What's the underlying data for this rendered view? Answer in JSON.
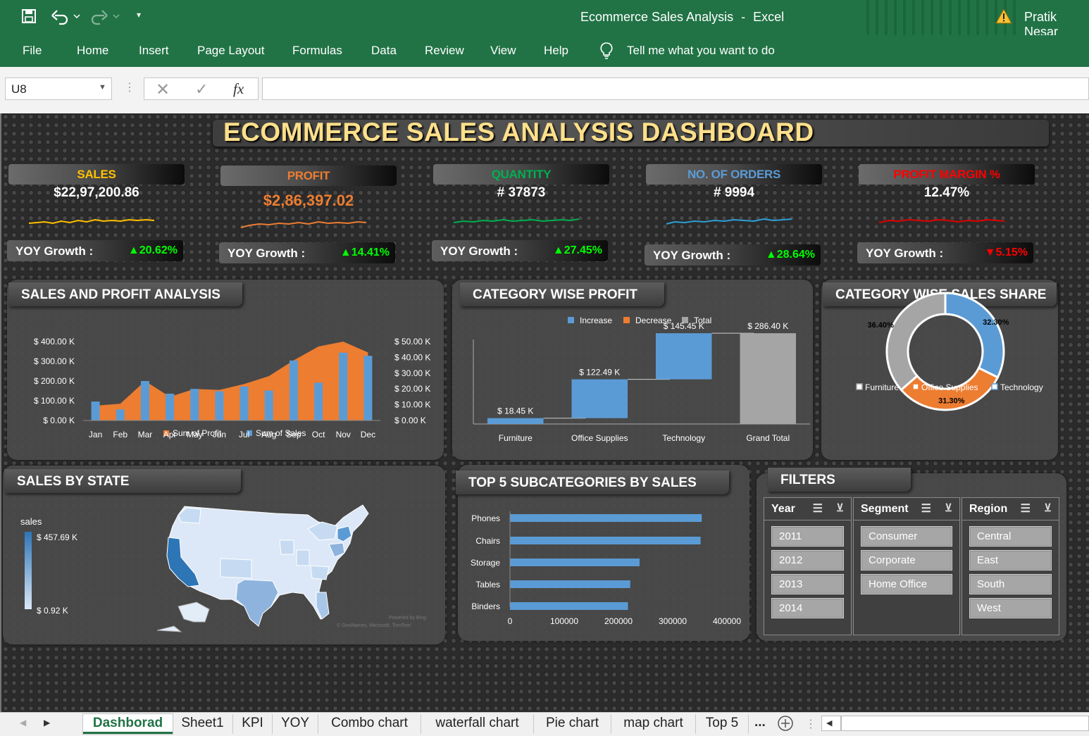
{
  "window": {
    "title": "Ecommerce Sales Analysis",
    "separator": "-",
    "app": "Excel",
    "user": "Pratik Nesar"
  },
  "ribbon": {
    "tabs": [
      "File",
      "Home",
      "Insert",
      "Page Layout",
      "Formulas",
      "Data",
      "Review",
      "View",
      "Help"
    ],
    "tell_me": "Tell me what you want to do"
  },
  "formula_bar": {
    "name_box": "U8",
    "fx": "fx",
    "formula": ""
  },
  "dashboard": {
    "title": "ECOMMERCE SALES ANALYSIS DASHBOARD"
  },
  "kpis": [
    {
      "label": "SALES",
      "value": "$22,97,200.86",
      "yoy_label": "YOY Growth :",
      "yoy": "▲20.62%",
      "label_color": "#ffc000",
      "value_color": "#ffffff",
      "line_color": "#ffc000",
      "yoy_color": "#00ff00"
    },
    {
      "label": "PROFIT",
      "value": "$2,86,397.02",
      "yoy_label": "YOY Growth :",
      "yoy": "▲14.41%",
      "label_color": "#ed7d31",
      "value_color": "#ed7d31",
      "line_color": "#ed7d31",
      "yoy_color": "#00ff00"
    },
    {
      "label": "QUANTITY",
      "value": "# 37873",
      "yoy_label": "YOY Growth :",
      "yoy": "▲27.45%",
      "label_color": "#00b050",
      "value_color": "#ffffff",
      "line_color": "#00b050",
      "yoy_color": "#00ff00"
    },
    {
      "label": "NO. OF ORDERS",
      "value": "# 9994",
      "yoy_label": "YOY Growth :",
      "yoy": "▲28.64%",
      "label_color": "#5b9bd5",
      "value_color": "#ffffff",
      "line_color": "#2e9fd6",
      "yoy_color": "#00ff00"
    },
    {
      "label": "PROFIT MARGIN %",
      "value": "12.47%",
      "yoy_label": "YOY Growth :",
      "yoy": "▼5.15%",
      "label_color": "#ff0000",
      "value_color": "#ffffff",
      "line_color": "#e00000",
      "yoy_color": "#ff0000"
    }
  ],
  "panels": {
    "sales_profit": "SALES AND PROFIT ANALYSIS",
    "category_profit": "CATEGORY WISE PROFIT",
    "category_share": "CATEGORY WISE SALES SHARE",
    "sales_by_state": "SALES BY STATE",
    "top5": "TOP 5 SUBCATEGORIES BY SALES",
    "filters": "FILTERS"
  },
  "chart_data": [
    {
      "type": "bar",
      "name": "combo",
      "categories": [
        "Jan",
        "Feb",
        "Mar",
        "Apr",
        "May",
        "Jun",
        "Jul",
        "Aug",
        "Sep",
        "Oct",
        "Nov",
        "Dec"
      ],
      "series": [
        {
          "name": "Sum of Profit",
          "type": "area",
          "axis": "left",
          "color": "#ed7d31",
          "values": [
            75,
            85,
            200,
            120,
            160,
            155,
            185,
            225,
            305,
            375,
            400,
            345
          ]
        },
        {
          "name": "Sum of Sales",
          "type": "bar",
          "axis": "right",
          "color": "#5b9bd5",
          "values": [
            12,
            7,
            25,
            17,
            20,
            18.5,
            21.5,
            19,
            38,
            24,
            43,
            41
          ]
        }
      ],
      "left_ticks": [
        "$ 400.00 K",
        "$ 300.00 K",
        "$ 200.00 K",
        "$ 100.00 K",
        "$ 0.00 K"
      ],
      "right_ticks": [
        "$ 50.00 K",
        "$ 40.00 K",
        "$ 30.00 K",
        "$ 20.00 K",
        "$ 10.00 K",
        "$ 0.00 K"
      ],
      "ylim_left": [
        0,
        400
      ],
      "ylim_right": [
        0,
        50
      ]
    },
    {
      "type": "bar",
      "name": "waterfall",
      "categories": [
        "Furniture",
        "Office Supplies",
        "Technology",
        "Grand Total"
      ],
      "legend": [
        "Increase",
        "Decrease",
        "Total"
      ],
      "values": [
        18.45,
        122.49,
        145.45,
        286.4
      ],
      "labels": [
        "$ 18.45 K",
        "$ 122.49 K",
        "$ 145.45 K",
        "$ 286.40 K"
      ],
      "ylim": [
        0,
        300
      ]
    },
    {
      "type": "pie",
      "name": "donut",
      "categories": [
        "Furniture",
        "Office Supplies",
        "Technology"
      ],
      "values": [
        36.4,
        31.3,
        32.3
      ],
      "labels": [
        "36.40%",
        "31.30%",
        "32.30%"
      ],
      "colors": [
        "#a5a5a5",
        "#ed7d31",
        "#5b9bd5"
      ]
    },
    {
      "type": "bar",
      "name": "top5",
      "categories": [
        "Phones",
        "Chairs",
        "Storage",
        "Tables",
        "Binders"
      ],
      "values": [
        330000,
        328000,
        223000,
        207000,
        203000
      ],
      "ticks": [
        "0",
        "100000",
        "200000",
        "300000",
        "400000"
      ],
      "xlim": [
        0,
        400000
      ]
    }
  ],
  "map": {
    "legend_title": "sales",
    "max": "$ 457.69 K",
    "min": "$ 0.92 K",
    "credit1": "Powered by Bing",
    "credit2": "© GeoNames, Microsoft, TomTom"
  },
  "slicers": [
    {
      "title": "Year",
      "items": [
        "2011",
        "2012",
        "2013",
        "2014"
      ]
    },
    {
      "title": "Segment",
      "items": [
        "Consumer",
        "Corporate",
        "Home Office"
      ]
    },
    {
      "title": "Region",
      "items": [
        "Central",
        "East",
        "South",
        "West"
      ]
    }
  ],
  "sheet_tabs": [
    "Dashborad",
    "Sheet1",
    "KPI",
    "YOY",
    "Combo chart",
    "waterfall chart",
    "Pie chart",
    "map chart",
    "Top 5"
  ],
  "sheet_more": "..."
}
